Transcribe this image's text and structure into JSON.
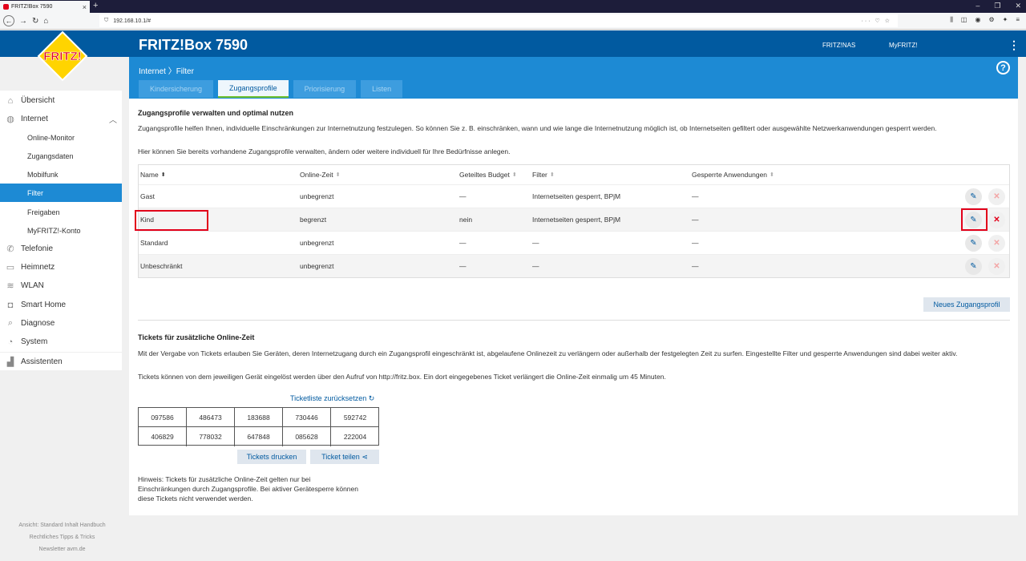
{
  "browser": {
    "tab_title": "FRITZ!Box 7590",
    "tab_close": "×",
    "new_tab": "+",
    "url": "192.168.10.1/#",
    "url_actions": "··· ♡ ☆"
  },
  "header": {
    "logo_text": "FRITZ!",
    "product": "FRITZ!Box 7590",
    "links": [
      "FRITZ!NAS",
      "MyFRITZ!"
    ],
    "breadcrumb": "Internet 〉Filter",
    "help": "?"
  },
  "tabs": [
    {
      "label": "Kindersicherung",
      "active": false
    },
    {
      "label": "Zugangsprofile",
      "active": true
    },
    {
      "label": "Priorisierung",
      "active": false
    },
    {
      "label": "Listen",
      "active": false
    }
  ],
  "sidebar": {
    "items": [
      {
        "label": "Übersicht",
        "icon": "⌂"
      },
      {
        "label": "Internet",
        "icon": "◍"
      },
      {
        "label": "Online-Monitor"
      },
      {
        "label": "Zugangsdaten"
      },
      {
        "label": "Mobilfunk"
      },
      {
        "label": "Filter"
      },
      {
        "label": "Freigaben"
      },
      {
        "label": "MyFRITZ!-Konto"
      },
      {
        "label": "Telefonie",
        "icon": "✆"
      },
      {
        "label": "Heimnetz",
        "icon": "▭"
      },
      {
        "label": "WLAN",
        "icon": "≋"
      },
      {
        "label": "Smart Home",
        "icon": "◘"
      },
      {
        "label": "Diagnose",
        "icon": "⌕"
      },
      {
        "label": "System",
        "icon": "◔"
      },
      {
        "label": "Assistenten",
        "icon": "▟"
      }
    ],
    "chevron": "︿"
  },
  "footer": {
    "line1": "Ansicht: Standard   Inhalt   Handbuch",
    "line2": "Rechtliches   Tipps & Tricks",
    "line3": "Newsletter   avm.de"
  },
  "profiles": {
    "title": "Zugangsprofile verwalten und optimal nutzen",
    "desc1": "Zugangsprofile helfen Ihnen, individuelle Einschränkungen zur Internetnutzung festzulegen. So können Sie z. B. einschränken, wann und wie lange die Internetnutzung möglich ist, ob Internetseiten gefiltert oder ausgewählte Netzwerkanwendungen gesperrt werden.",
    "desc2": "Hier können Sie bereits vorhandene Zugangsprofile verwalten, ändern oder weitere individuell für Ihre Bedürfnisse anlegen.",
    "columns": [
      "Name",
      "Online-Zeit",
      "Geteiltes Budget",
      "Filter",
      "Gesperrte Anwendungen"
    ],
    "rows": [
      {
        "name": "Gast",
        "online": "unbegrenzt",
        "budget": "—",
        "filter": "Internetseiten gesperrt, BPjM",
        "blocked": "—"
      },
      {
        "name": "Kind",
        "online": "begrenzt",
        "budget": "nein",
        "filter": "Internetseiten gesperrt, BPjM",
        "blocked": "—"
      },
      {
        "name": "Standard",
        "online": "unbegrenzt",
        "budget": "—",
        "filter": "—",
        "blocked": "—"
      },
      {
        "name": "Unbeschränkt",
        "online": "unbegrenzt",
        "budget": "—",
        "filter": "—",
        "blocked": "—"
      }
    ],
    "new_button": "Neues Zugangsprofil"
  },
  "tickets": {
    "title": "Tickets für zusätzliche Online-Zeit",
    "desc1": "Mit der Vergabe von Tickets erlauben Sie Geräten, deren Internetzugang durch ein Zugangsprofil eingeschränkt ist, abgelaufene Onlinezeit zu verlängern oder außerhalb der festgelegten Zeit zu surfen. Eingestellte Filter und gesperrte Anwendungen sind dabei weiter aktiv.",
    "desc2": "Tickets können von dem jeweiligen Gerät eingelöst werden über den Aufruf von http://fritz.box. Ein dort eingegebenes Ticket verlängert die Online-Zeit einmalig um 45 Minuten.",
    "reset": "Ticketliste zurücksetzen",
    "codes": [
      [
        "097586",
        "486473",
        "183688",
        "730446",
        "592742"
      ],
      [
        "406829",
        "778032",
        "647848",
        "085628",
        "222004"
      ]
    ],
    "print": "Tickets drucken",
    "share": "Ticket teilen",
    "note": "Hinweis: Tickets für zusätzliche Online-Zeit gelten nur bei Einschränkungen durch Zugangsprofile. Bei aktiver Gerätesperre können diese Tickets nicht verwendet werden."
  }
}
